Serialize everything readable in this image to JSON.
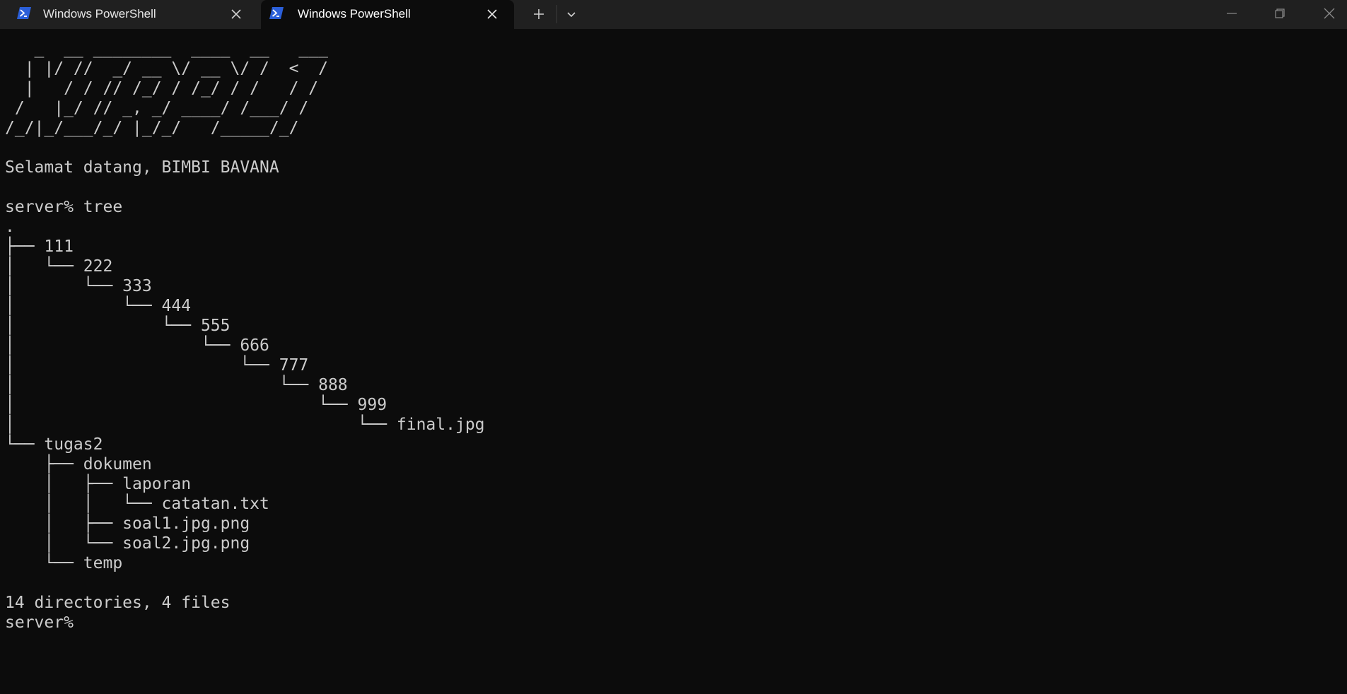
{
  "tabs": [
    {
      "title": "Windows PowerShell",
      "active": false
    },
    {
      "title": "Windows PowerShell",
      "active": true
    }
  ],
  "colors": {
    "tabbar_bg": "#202020",
    "terminal_bg": "#0c0c0c",
    "terminal_fg": "#cccccc",
    "powershell_icon": "#2b5fd9"
  },
  "icons": {
    "tab_icon": "powershell-icon",
    "tab_close": "close-icon",
    "new_tab": "plus-icon",
    "tab_dropdown": "chevron-down-icon",
    "minimize": "minimize-icon",
    "maximize": "restore-icon",
    "close": "close-icon"
  },
  "terminal": {
    "lines": [
      "   _  __ ________  ____  __   ___",
      "  | |/ //  _/ __ \\/ __ \\/ /  <  /",
      "  |   / / // /_/ / /_/ / /   / /",
      " /   |_/ // _, _/ ____/ /___/ /",
      "/_/|_/___/_/ |_/_/   /_____/_/",
      "",
      "Selamat datang, BIMBI BAVANA",
      "",
      "server% tree",
      ".",
      "├── 111",
      "│   └── 222",
      "│       └── 333",
      "│           └── 444",
      "│               └── 555",
      "│                   └── 666",
      "│                       └── 777",
      "│                           └── 888",
      "│                               └── 999",
      "│                                   └── final.jpg",
      "└── tugas2",
      "    ├── dokumen",
      "    │   ├── laporan",
      "    │   │   └── catatan.txt",
      "    │   ├── soal1.jpg.png",
      "    │   └── soal2.jpg.png",
      "    └── temp",
      "",
      "14 directories, 4 files",
      "server% "
    ]
  }
}
